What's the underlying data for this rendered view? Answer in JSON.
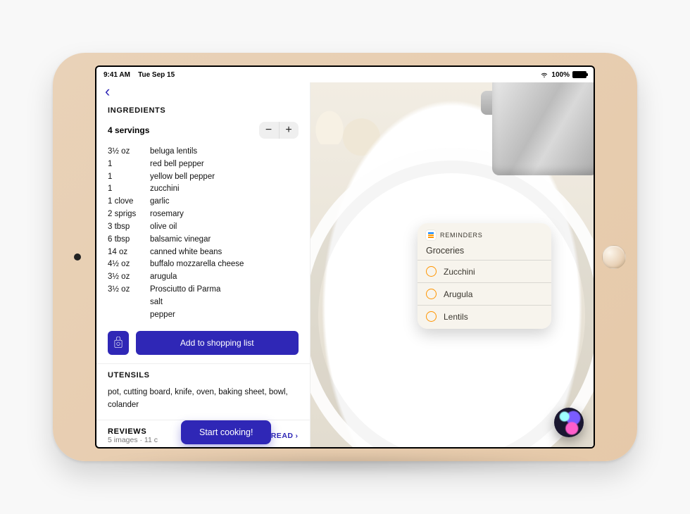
{
  "status": {
    "time": "9:41 AM",
    "date": "Tue Sep 15",
    "battery": "100%"
  },
  "navigation": {
    "back_glyph": "‹"
  },
  "ingredients_section": {
    "heading": "INGREDIENTS",
    "servings": "4 servings",
    "items": [
      {
        "qty": "3½ oz",
        "name": "beluga lentils"
      },
      {
        "qty": "1",
        "name": "red bell pepper"
      },
      {
        "qty": "1",
        "name": "yellow bell pepper"
      },
      {
        "qty": "1",
        "name": "zucchini"
      },
      {
        "qty": "1 clove",
        "name": "garlic"
      },
      {
        "qty": "2 sprigs",
        "name": "rosemary"
      },
      {
        "qty": "3 tbsp",
        "name": "olive oil"
      },
      {
        "qty": "6 tbsp",
        "name": "balsamic vinegar"
      },
      {
        "qty": "14 oz",
        "name": "canned white beans"
      },
      {
        "qty": "4½ oz",
        "name": "buffalo mozzarella cheese"
      },
      {
        "qty": "3½ oz",
        "name": "arugula"
      },
      {
        "qty": "3½ oz",
        "name": "Prosciutto di Parma"
      },
      {
        "qty": "",
        "name": "salt"
      },
      {
        "qty": "",
        "name": "pepper"
      }
    ],
    "add_button": "Add to shopping list"
  },
  "utensils_section": {
    "heading": "UTENSILS",
    "text": "pot, cutting board, knife, oven, baking sheet, bowl, colander"
  },
  "reviews_section": {
    "heading": "REVIEWS",
    "sub": "5 images · 11 c",
    "read": "READ"
  },
  "start_button": "Start cooking!",
  "reminders": {
    "app_label": "REMINDERS",
    "list_title": "Groceries",
    "items": [
      "Zucchini",
      "Arugula",
      "Lentils"
    ]
  }
}
